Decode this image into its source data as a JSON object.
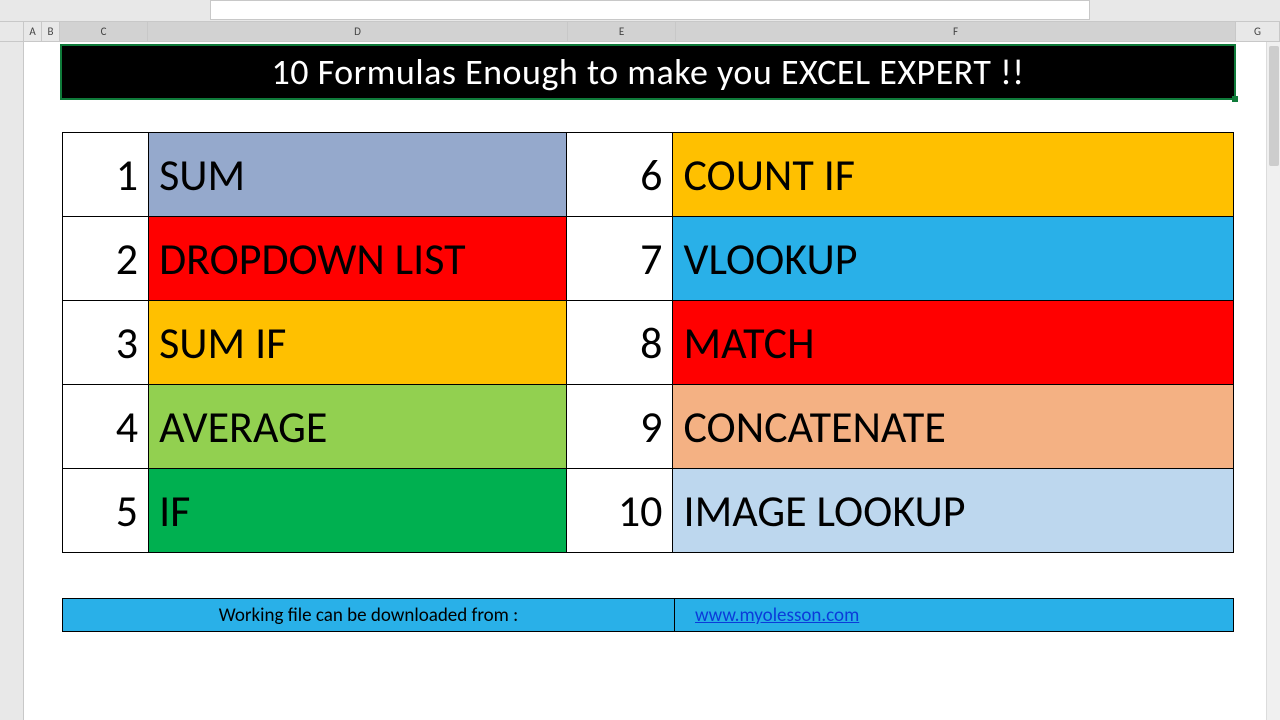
{
  "columns": {
    "a": "A",
    "b": "B",
    "c": "C",
    "d": "D",
    "e": "E",
    "f": "F",
    "g": "G"
  },
  "title": "10 Formulas Enough to make you EXCEL EXPERT !!",
  "left_items": [
    {
      "n": "1",
      "label": "SUM",
      "bg": "#95a9cc"
    },
    {
      "n": "2",
      "label": "DROPDOWN LIST",
      "bg": "#ff0000"
    },
    {
      "n": "3",
      "label": "SUM IF",
      "bg": "#ffc000"
    },
    {
      "n": "4",
      "label": "AVERAGE",
      "bg": "#92d050"
    },
    {
      "n": "5",
      "label": "IF",
      "bg": "#00b050"
    }
  ],
  "right_items": [
    {
      "n": "6",
      "label": "COUNT IF",
      "bg": "#ffc000"
    },
    {
      "n": "7",
      "label": "VLOOKUP",
      "bg": "#29b0e8"
    },
    {
      "n": "8",
      "label": "MATCH",
      "bg": "#ff0000"
    },
    {
      "n": "9",
      "label": "CONCATENATE",
      "bg": "#f4b183"
    },
    {
      "n": "10",
      "label": "IMAGE LOOKUP",
      "bg": "#bdd7ee"
    }
  ],
  "footer": {
    "text": "Working file can be downloaded from :",
    "link": "www.myolesson.com"
  }
}
